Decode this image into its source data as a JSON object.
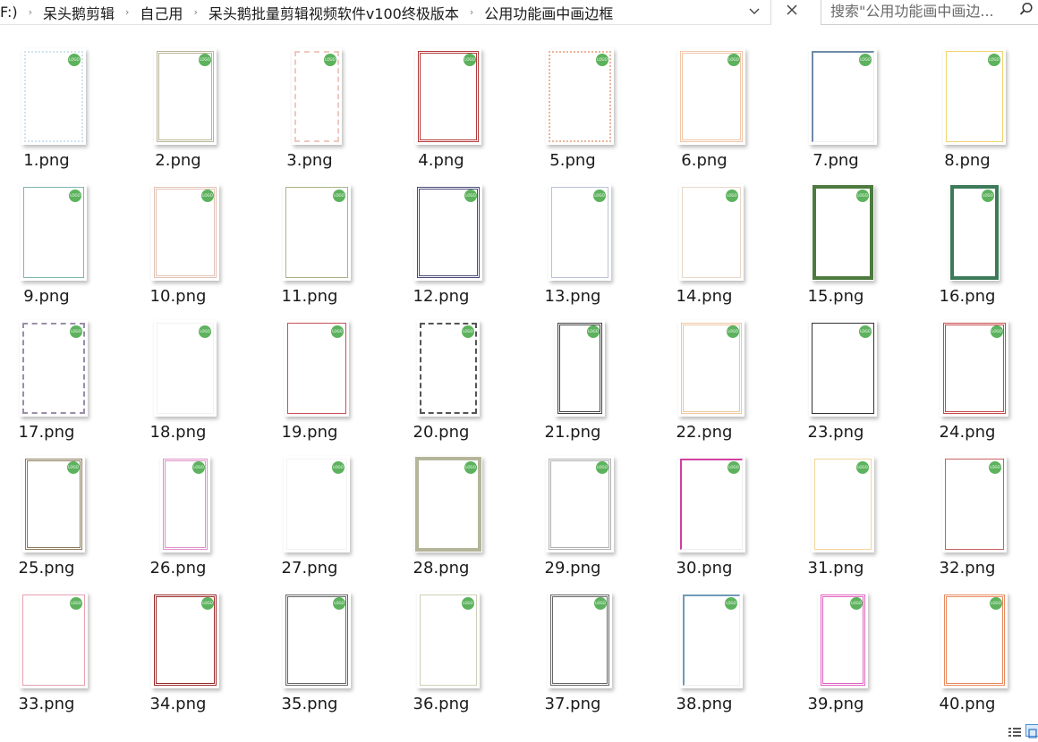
{
  "breadcrumb": {
    "drive": "F:)",
    "items": [
      "呆头鹅剪辑",
      "自己用",
      "呆头鹅批量剪辑视频软件v100终极版本",
      "公用功能画中画边框"
    ]
  },
  "search": {
    "placeholder": "搜索\"公用功能画中画边..."
  },
  "badge_text": "LOGO",
  "files": [
    {
      "name": "1.png",
      "color": "#cfe3ef",
      "style": "dots"
    },
    {
      "name": "2.png",
      "color": "#b9b59a",
      "style": "double"
    },
    {
      "name": "3.png",
      "color": "#f0c8c0",
      "style": "dashed"
    },
    {
      "name": "4.png",
      "color": "#b23a3a",
      "style": "double"
    },
    {
      "name": "5.png",
      "color": "#eab49a",
      "style": "dots"
    },
    {
      "name": "6.png",
      "color": "#efc6a8",
      "style": "double"
    },
    {
      "name": "7.png",
      "color": "#6e8aa8",
      "style": "corner"
    },
    {
      "name": "8.png",
      "color": "#f1d36e",
      "style": "solid"
    },
    {
      "name": "9.png",
      "color": "#7fb6b0",
      "style": "solid"
    },
    {
      "name": "10.png",
      "color": "#e2c2b6",
      "style": "double"
    },
    {
      "name": "11.png",
      "color": "#a8b48a",
      "style": "solid"
    },
    {
      "name": "12.png",
      "color": "#4a4a7a",
      "style": "double"
    },
    {
      "name": "13.png",
      "color": "#b9c2d8",
      "style": "solid"
    },
    {
      "name": "14.png",
      "color": "#e8d8c8",
      "style": "solid"
    },
    {
      "name": "15.png",
      "color": "#4d7a3f",
      "style": "thick"
    },
    {
      "name": "16.png",
      "color": "#3c7a5a",
      "style": "thick"
    },
    {
      "name": "17.png",
      "color": "#9a8ea8",
      "style": "dashed"
    },
    {
      "name": "18.png",
      "color": "#bfe0d8",
      "style": "none"
    },
    {
      "name": "19.png",
      "color": "#c8505a",
      "style": "solid"
    },
    {
      "name": "20.png",
      "color": "#555555",
      "style": "dashed"
    },
    {
      "name": "21.png",
      "color": "#444444",
      "style": "double"
    },
    {
      "name": "22.png",
      "color": "#efc6a0",
      "style": "double"
    },
    {
      "name": "23.png",
      "color": "#333333",
      "style": "solid"
    },
    {
      "name": "24.png",
      "color": "#c84848",
      "style": "double"
    },
    {
      "name": "25.png",
      "color": "#8a7a5a",
      "style": "double"
    },
    {
      "name": "26.png",
      "color": "#e090c8",
      "style": "double"
    },
    {
      "name": "27.png",
      "color": "#dddddd",
      "style": "none"
    },
    {
      "name": "28.png",
      "color": "#b5b59a",
      "style": "thick"
    },
    {
      "name": "29.png",
      "color": "#b0b0b0",
      "style": "double"
    },
    {
      "name": "30.png",
      "color": "#d040a0",
      "style": "corner"
    },
    {
      "name": "31.png",
      "color": "#f3d49a",
      "style": "solid"
    },
    {
      "name": "32.png",
      "color": "#c86060",
      "style": "solid"
    },
    {
      "name": "33.png",
      "color": "#e8a0b0",
      "style": "solid"
    },
    {
      "name": "34.png",
      "color": "#9a2a2a",
      "style": "double"
    },
    {
      "name": "35.png",
      "color": "#666666",
      "style": "double"
    },
    {
      "name": "36.png",
      "color": "#cfcfb8",
      "style": "solid"
    },
    {
      "name": "37.png",
      "color": "#666666",
      "style": "double"
    },
    {
      "name": "38.png",
      "color": "#6e9ab8",
      "style": "corner"
    },
    {
      "name": "39.png",
      "color": "#e060c0",
      "style": "double"
    },
    {
      "name": "40.png",
      "color": "#e88a60",
      "style": "double"
    }
  ]
}
